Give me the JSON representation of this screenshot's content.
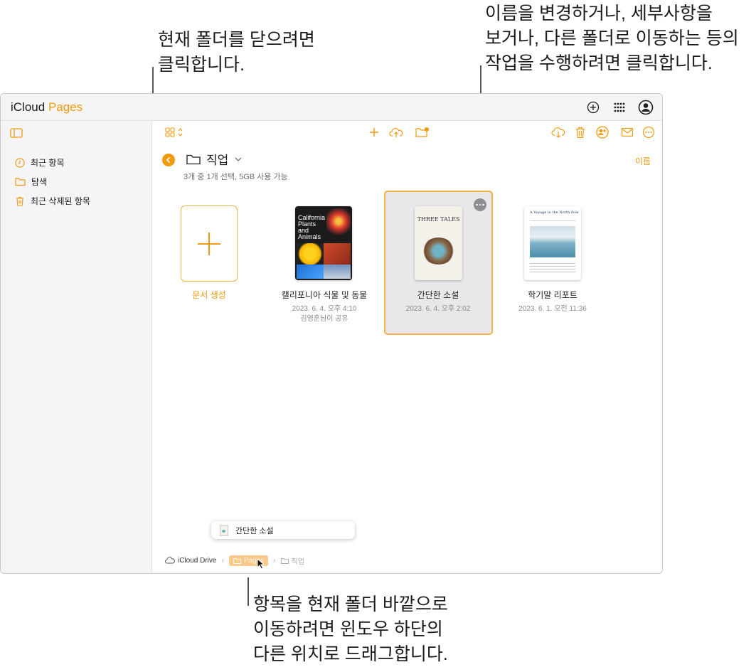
{
  "callouts": {
    "close_folder": [
      "현재 폴더를 닫으려면",
      "클릭합니다."
    ],
    "more_actions": [
      "이름을 변경하거나, 세부사항을",
      "보거나, 다른 폴더로 이동하는 등의",
      "작업을 수행하려면 클릭합니다."
    ],
    "drag_move": [
      "항목을 현재 폴더 바깥으로",
      "이동하려면 윈도우 하단의",
      "다른 위치로 드래그합니다."
    ]
  },
  "app": {
    "apple": "",
    "brand": "iCloud",
    "product": "Pages"
  },
  "topbar_icons": [
    "plus-circle-icon",
    "app-grid-icon",
    "account-icon"
  ],
  "sidebar": {
    "items": [
      {
        "label": "최근 항목",
        "icon": "clock-icon"
      },
      {
        "label": "탐색",
        "icon": "folder-icon"
      },
      {
        "label": "최근 삭제된 항목",
        "icon": "trash-icon"
      }
    ]
  },
  "toolbar": {
    "left": [
      "view-grid-icon"
    ],
    "center": [
      "add-icon",
      "upload-icon",
      "new-folder-icon"
    ],
    "right": [
      "download-icon",
      "delete-icon",
      "share-icon",
      "mail-icon",
      "more-icon"
    ]
  },
  "folder": {
    "title": "직업",
    "info": "3개 중 1개 선택, 5GB 사용 가능",
    "sort_label": "이름"
  },
  "documents": [
    {
      "name": "문서 생성",
      "date": "",
      "shared": ""
    },
    {
      "name": "캘리포니아 식물 및 동물",
      "date": "2023. 6. 4. 오후 4:10",
      "shared": "김영훈님이 공유",
      "thumb_title": "California Plants and Animals"
    },
    {
      "name": "간단한 소설",
      "date": "2023. 6. 4. 오후 2:02",
      "shared": "",
      "thumb_title": "THREE TALES"
    },
    {
      "name": "학기말 리포트",
      "date": "2023. 6. 1. 오전 11:36",
      "shared": "",
      "thumb_title": "A Voyage to the North Pole"
    }
  ],
  "drag_item": {
    "label": "간단한 소설"
  },
  "breadcrumb": {
    "root": "iCloud Drive",
    "middle": "Pages",
    "current": "직업"
  },
  "colors": {
    "accent": "#f19a0d",
    "selection_bg": "#e8e8ea"
  }
}
